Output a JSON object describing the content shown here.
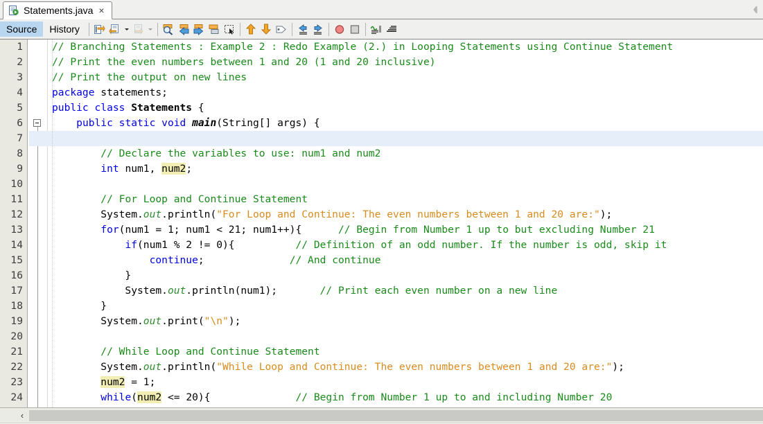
{
  "window": {
    "file_tab": {
      "title": "Statements.java",
      "icon": "java-file-icon",
      "close_label": "×"
    },
    "collapse_arrow_icon": "collapse-left-arrow-icon"
  },
  "view_tabs": [
    {
      "label": "Source",
      "active": true
    },
    {
      "label": "History",
      "active": false
    }
  ],
  "toolbar": {
    "groups": [
      {
        "buttons": [
          {
            "icon": "last-edit-icon",
            "label": "Last Edit"
          },
          {
            "icon": "shift-line-left-icon",
            "label": "Shift Line Left"
          },
          {
            "icon": "dropdown-arrow-icon",
            "label": "More",
            "dropdown": true
          },
          {
            "icon": "shift-line-right-icon",
            "label": "Shift Line Right",
            "disabled": true
          },
          {
            "icon": "dropdown-arrow-icon",
            "label": "More",
            "dropdown": true,
            "disabled": true
          }
        ]
      },
      {
        "buttons": [
          {
            "icon": "find-selection-icon",
            "label": "Find Selection"
          },
          {
            "icon": "previous-bookmark-icon",
            "label": "Previous Bookmark"
          },
          {
            "icon": "next-bookmark-icon",
            "label": "Next Bookmark"
          },
          {
            "icon": "toggle-bookmark-icon",
            "label": "Toggle Bookmark"
          },
          {
            "icon": "toggle-rectangular-selection-icon",
            "label": "Toggle Rectangular Selection"
          }
        ]
      },
      {
        "buttons": [
          {
            "icon": "previous-error-icon",
            "label": "Previous Error"
          },
          {
            "icon": "next-error-icon",
            "label": "Next Error"
          },
          {
            "icon": "inspect-icon",
            "label": "Inspect"
          }
        ]
      },
      {
        "buttons": [
          {
            "icon": "shift-left-icon",
            "label": "Shift Left"
          },
          {
            "icon": "shift-right-icon",
            "label": "Shift Right"
          }
        ]
      },
      {
        "buttons": [
          {
            "icon": "toggle-breakpoint-icon",
            "label": "Toggle Breakpoint"
          },
          {
            "icon": "stop-icon",
            "label": "Stop"
          }
        ]
      },
      {
        "buttons": [
          {
            "icon": "toggle-highlight-search-icon",
            "label": "Toggle Highlight Search"
          },
          {
            "icon": "previous-matching-word-icon",
            "label": "Previous Matching Word"
          }
        ]
      }
    ]
  },
  "editor": {
    "caret_line": 7,
    "fold_marker_line": 6,
    "scrollbar": {
      "left_arrow": "‹"
    },
    "lines": [
      {
        "n": 1,
        "tokens": [
          {
            "t": "// Branching Statements : Example 2 : Redo Example (2.) in Looping Statements using Continue Statement",
            "c": "cmt"
          }
        ],
        "indent": 0
      },
      {
        "n": 2,
        "tokens": [
          {
            "t": "// Print the even numbers between 1 and 20 (1 and 20 inclusive)",
            "c": "cmt"
          }
        ],
        "indent": 0
      },
      {
        "n": 3,
        "tokens": [
          {
            "t": "// Print the output on new lines",
            "c": "cmt"
          }
        ],
        "indent": 0
      },
      {
        "n": 4,
        "tokens": [
          {
            "t": "package",
            "c": "kw"
          },
          {
            "t": " statements;",
            "c": "pln"
          }
        ],
        "indent": 0
      },
      {
        "n": 5,
        "tokens": [
          {
            "t": "public class",
            "c": "kw"
          },
          {
            "t": " ",
            "c": "pln"
          },
          {
            "t": "Statements",
            "c": "bold"
          },
          {
            "t": " {",
            "c": "pln"
          }
        ],
        "indent": 0
      },
      {
        "n": 6,
        "tokens": [
          {
            "t": "    ",
            "c": "pln"
          },
          {
            "t": "public static void",
            "c": "kw"
          },
          {
            "t": " ",
            "c": "pln"
          },
          {
            "t": "main",
            "c": "itbold"
          },
          {
            "t": "(String[] args) {",
            "c": "pln"
          }
        ],
        "indent": 0
      },
      {
        "n": 7,
        "tokens": [],
        "indent": 0
      },
      {
        "n": 8,
        "tokens": [
          {
            "t": "        ",
            "c": "pln"
          },
          {
            "t": "// Declare the variables to use: num1 and num2",
            "c": "cmt"
          }
        ],
        "indent": 0
      },
      {
        "n": 9,
        "tokens": [
          {
            "t": "        ",
            "c": "pln"
          },
          {
            "t": "int",
            "c": "kw"
          },
          {
            "t": " num1, ",
            "c": "pln"
          },
          {
            "t": "num2",
            "c": "pln",
            "hl": true
          },
          {
            "t": ";",
            "c": "pln"
          }
        ],
        "indent": 0
      },
      {
        "n": 10,
        "tokens": [],
        "indent": 0
      },
      {
        "n": 11,
        "tokens": [
          {
            "t": "        ",
            "c": "pln"
          },
          {
            "t": "// For Loop and Continue Statement",
            "c": "cmt"
          }
        ],
        "indent": 0
      },
      {
        "n": 12,
        "tokens": [
          {
            "t": "        System.",
            "c": "pln"
          },
          {
            "t": "out",
            "c": "fld"
          },
          {
            "t": ".println(",
            "c": "pln"
          },
          {
            "t": "\"For Loop and Continue: The even numbers between 1 and 20 are:\"",
            "c": "str"
          },
          {
            "t": ");",
            "c": "pln"
          }
        ],
        "indent": 0
      },
      {
        "n": 13,
        "tokens": [
          {
            "t": "        ",
            "c": "pln"
          },
          {
            "t": "for",
            "c": "kw"
          },
          {
            "t": "(num1 = 1; num1 < 21; num1++){      ",
            "c": "pln"
          },
          {
            "t": "// Begin from Number 1 up to but excluding Number 21",
            "c": "cmt"
          }
        ],
        "indent": 0
      },
      {
        "n": 14,
        "tokens": [
          {
            "t": "            ",
            "c": "pln"
          },
          {
            "t": "if",
            "c": "kw"
          },
          {
            "t": "(num1 % 2 != 0){          ",
            "c": "pln"
          },
          {
            "t": "// Definition of an odd number. If the number is odd, skip it",
            "c": "cmt"
          }
        ],
        "indent": 0
      },
      {
        "n": 15,
        "tokens": [
          {
            "t": "                ",
            "c": "pln"
          },
          {
            "t": "continue",
            "c": "kw"
          },
          {
            "t": ";              ",
            "c": "pln"
          },
          {
            "t": "// And continue",
            "c": "cmt"
          }
        ],
        "indent": 0
      },
      {
        "n": 16,
        "tokens": [
          {
            "t": "            }",
            "c": "pln"
          }
        ],
        "indent": 0
      },
      {
        "n": 17,
        "tokens": [
          {
            "t": "            System.",
            "c": "pln"
          },
          {
            "t": "out",
            "c": "fld"
          },
          {
            "t": ".println(num1);       ",
            "c": "pln"
          },
          {
            "t": "// Print each even number on a new line",
            "c": "cmt"
          }
        ],
        "indent": 0
      },
      {
        "n": 18,
        "tokens": [
          {
            "t": "        }",
            "c": "pln"
          }
        ],
        "indent": 0
      },
      {
        "n": 19,
        "tokens": [
          {
            "t": "        System.",
            "c": "pln"
          },
          {
            "t": "out",
            "c": "fld"
          },
          {
            "t": ".print(",
            "c": "pln"
          },
          {
            "t": "\"\\n\"",
            "c": "str"
          },
          {
            "t": ");",
            "c": "pln"
          }
        ],
        "indent": 0
      },
      {
        "n": 20,
        "tokens": [],
        "indent": 0
      },
      {
        "n": 21,
        "tokens": [
          {
            "t": "        ",
            "c": "pln"
          },
          {
            "t": "// While Loop and Continue Statement",
            "c": "cmt"
          }
        ],
        "indent": 0
      },
      {
        "n": 22,
        "tokens": [
          {
            "t": "        System.",
            "c": "pln"
          },
          {
            "t": "out",
            "c": "fld"
          },
          {
            "t": ".println(",
            "c": "pln"
          },
          {
            "t": "\"While Loop and Continue: The even numbers between 1 and 20 are:\"",
            "c": "str"
          },
          {
            "t": ");",
            "c": "pln"
          }
        ],
        "indent": 0
      },
      {
        "n": 23,
        "tokens": [
          {
            "t": "        ",
            "c": "pln"
          },
          {
            "t": "num2",
            "c": "pln",
            "hl": true
          },
          {
            "t": " = 1;",
            "c": "pln"
          }
        ],
        "indent": 0
      },
      {
        "n": 24,
        "tokens": [
          {
            "t": "        ",
            "c": "pln"
          },
          {
            "t": "while",
            "c": "kw"
          },
          {
            "t": "(",
            "c": "pln"
          },
          {
            "t": "num2",
            "c": "pln",
            "hl": true
          },
          {
            "t": " <= 20){              ",
            "c": "pln"
          },
          {
            "t": "// Begin from Number 1 up to and including Number 20",
            "c": "cmt"
          }
        ],
        "indent": 0
      }
    ]
  }
}
